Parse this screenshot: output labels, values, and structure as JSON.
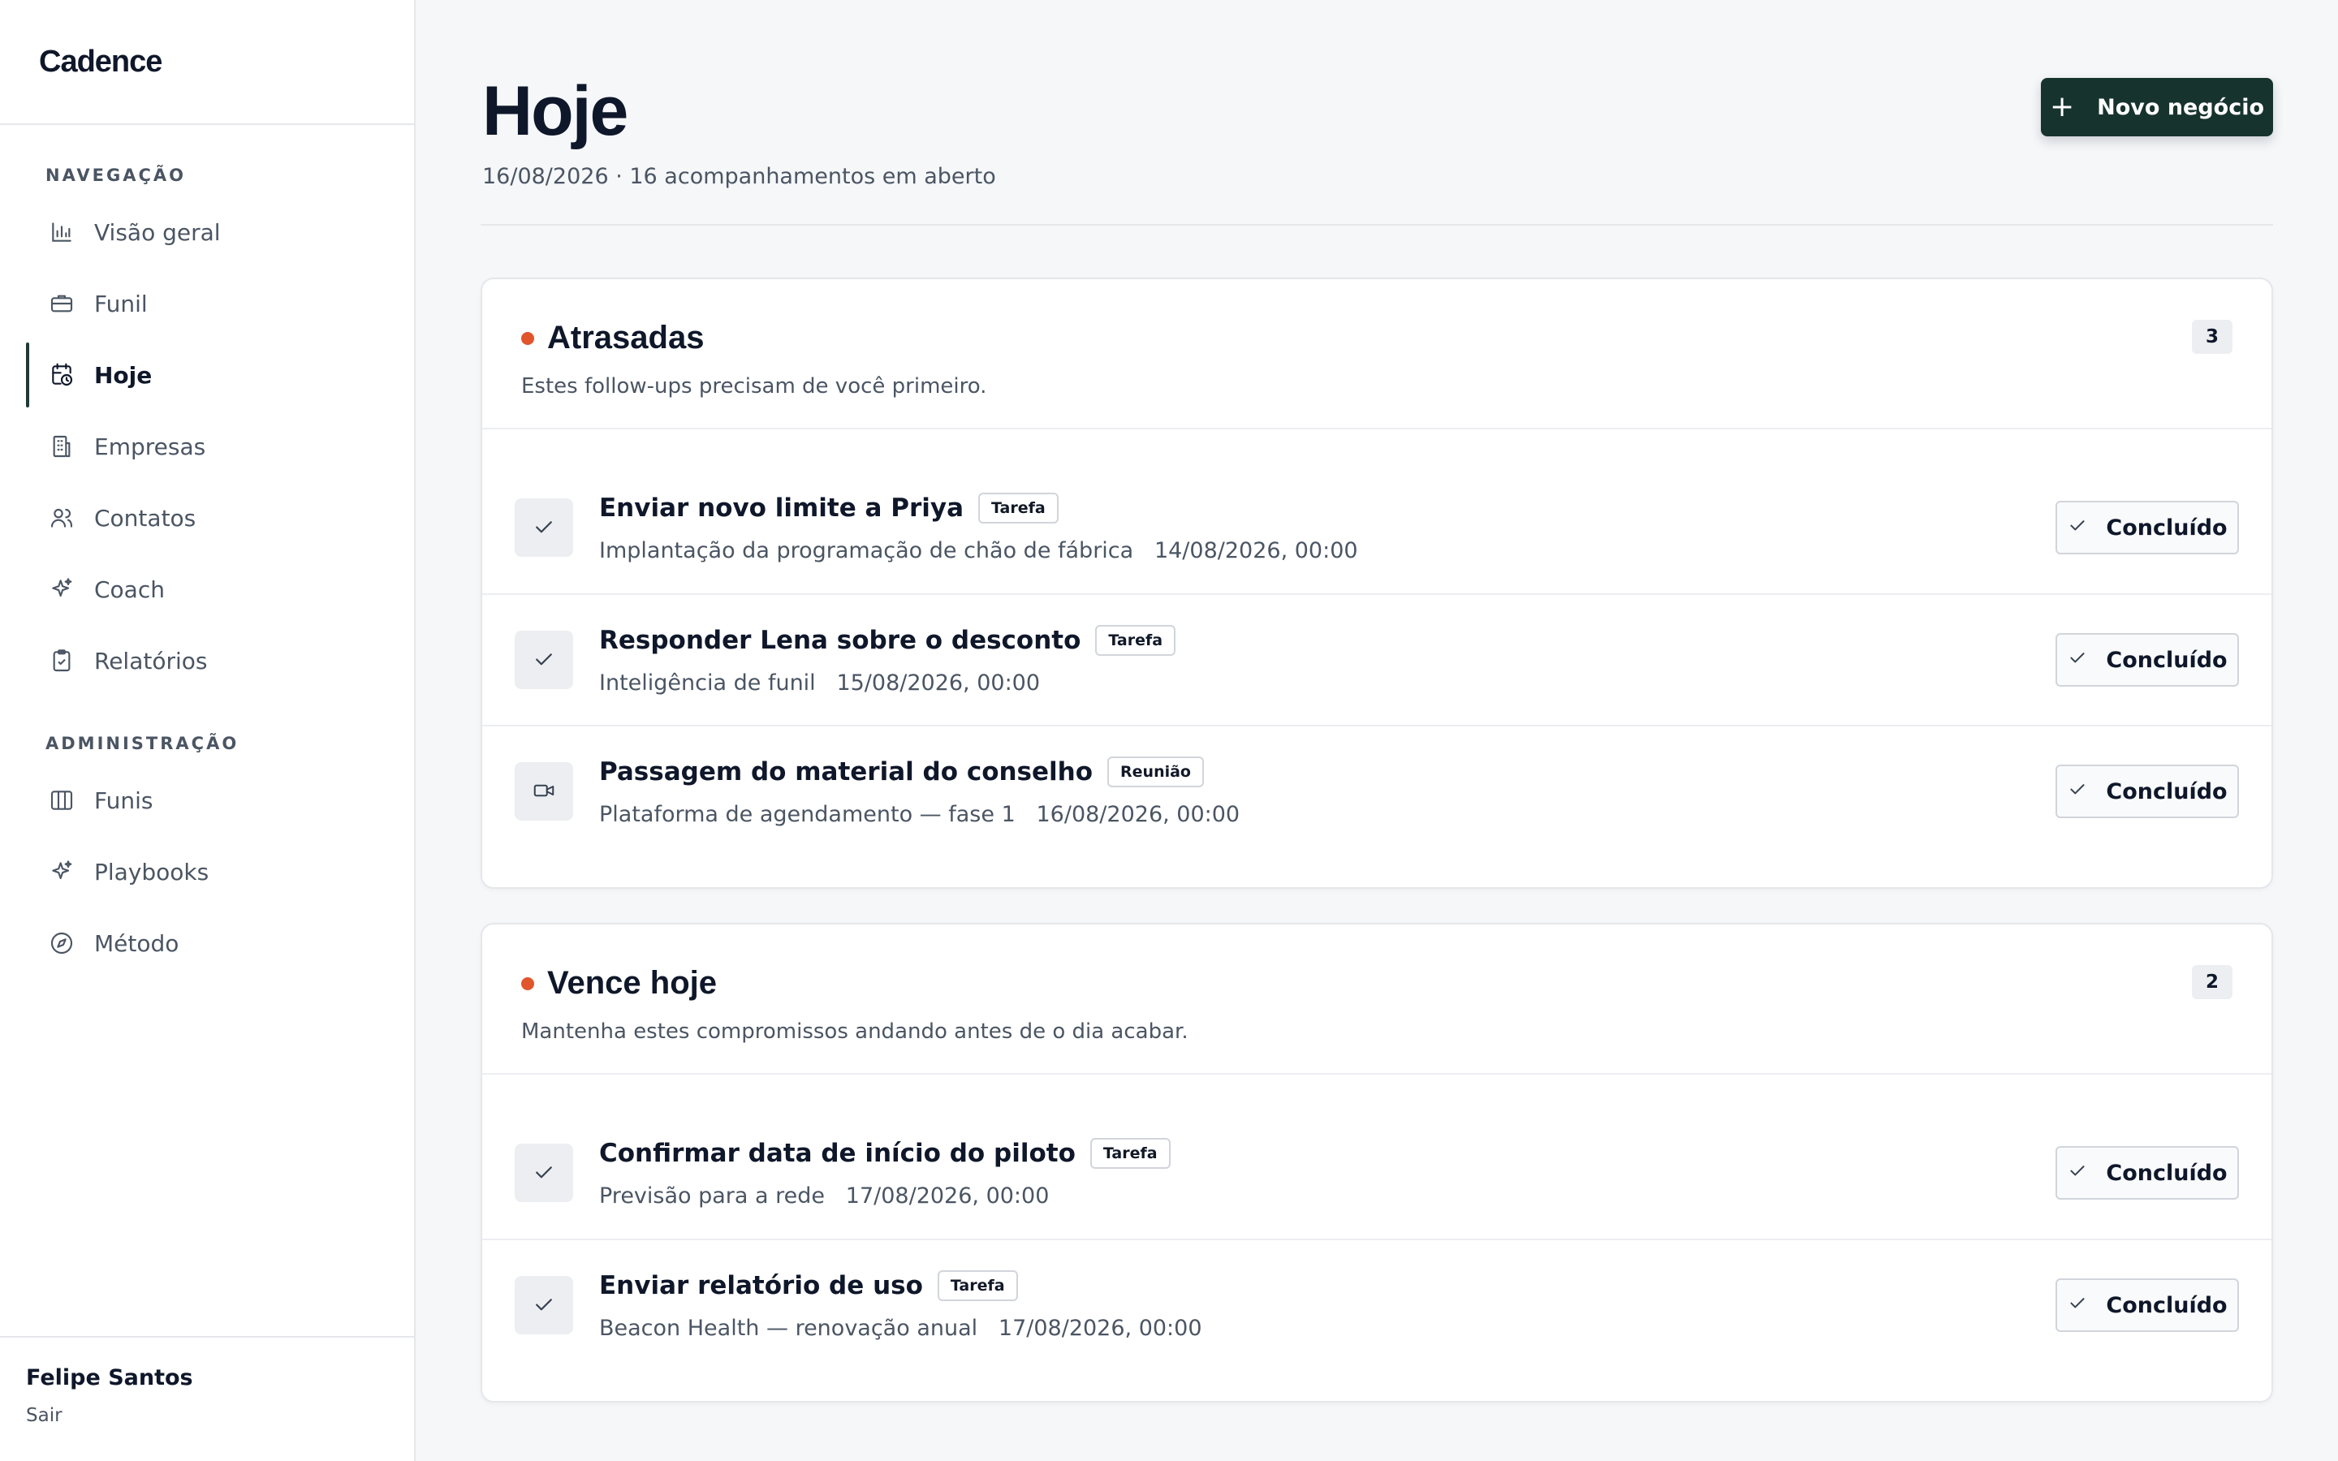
{
  "app": {
    "brand": "Cadence"
  },
  "sidebar": {
    "nav_label": "NAVEGAÇÃO",
    "nav_items": [
      {
        "label": "Visão geral",
        "icon": "bar-chart-icon"
      },
      {
        "label": "Funil",
        "icon": "briefcase-icon"
      },
      {
        "label": "Hoje",
        "icon": "calendar-clock-icon",
        "active": true
      },
      {
        "label": "Empresas",
        "icon": "building-icon"
      },
      {
        "label": "Contatos",
        "icon": "users-icon"
      },
      {
        "label": "Coach",
        "icon": "sparkles-icon"
      },
      {
        "label": "Relatórios",
        "icon": "clipboard-check-icon"
      }
    ],
    "admin_label": "ADMINISTRAÇÃO",
    "admin_items": [
      {
        "label": "Funis",
        "icon": "columns-icon"
      },
      {
        "label": "Playbooks",
        "icon": "sparkles-icon"
      },
      {
        "label": "Método",
        "icon": "compass-icon"
      }
    ],
    "user": {
      "name": "Felipe Santos",
      "signout": "Sair"
    }
  },
  "page": {
    "title": "Hoje",
    "subtitle": "16/08/2026 · 16 acompanhamentos em aberto",
    "primary_button": {
      "label": "Novo negócio",
      "icon": "plus-icon"
    }
  },
  "sections": [
    {
      "title": "Atrasadas",
      "count": "3",
      "description": "Estes follow-ups precisam de você primeiro.",
      "dot_color": "#e0552b",
      "tasks": [
        {
          "title": "Enviar novo limite a Priya",
          "tag": "Tarefa",
          "deal": "Implantação da programação de chão de fábrica",
          "due": "14/08/2026, 00:00",
          "icon": "check-icon",
          "action": "Concluído"
        },
        {
          "title": "Responder Lena sobre o desconto",
          "tag": "Tarefa",
          "deal": "Inteligência de funil",
          "due": "15/08/2026, 00:00",
          "icon": "check-icon",
          "action": "Concluído"
        },
        {
          "title": "Passagem do material do conselho",
          "tag": "Reunião",
          "deal": "Plataforma de agendamento — fase 1",
          "due": "16/08/2026, 00:00",
          "icon": "video-icon",
          "action": "Concluído"
        }
      ]
    },
    {
      "title": "Vence hoje",
      "count": "2",
      "description": "Mantenha estes compromissos andando antes de o dia acabar.",
      "dot_color": "#e0552b",
      "tasks": [
        {
          "title": "Confirmar data de início do piloto",
          "tag": "Tarefa",
          "deal": "Previsão para a rede",
          "due": "17/08/2026, 00:00",
          "icon": "check-icon",
          "action": "Concluído"
        },
        {
          "title": "Enviar relatório de uso",
          "tag": "Tarefa",
          "deal": "Beacon Health — renovação anual",
          "due": "17/08/2026, 00:00",
          "icon": "check-icon",
          "action": "Concluído"
        }
      ]
    }
  ]
}
